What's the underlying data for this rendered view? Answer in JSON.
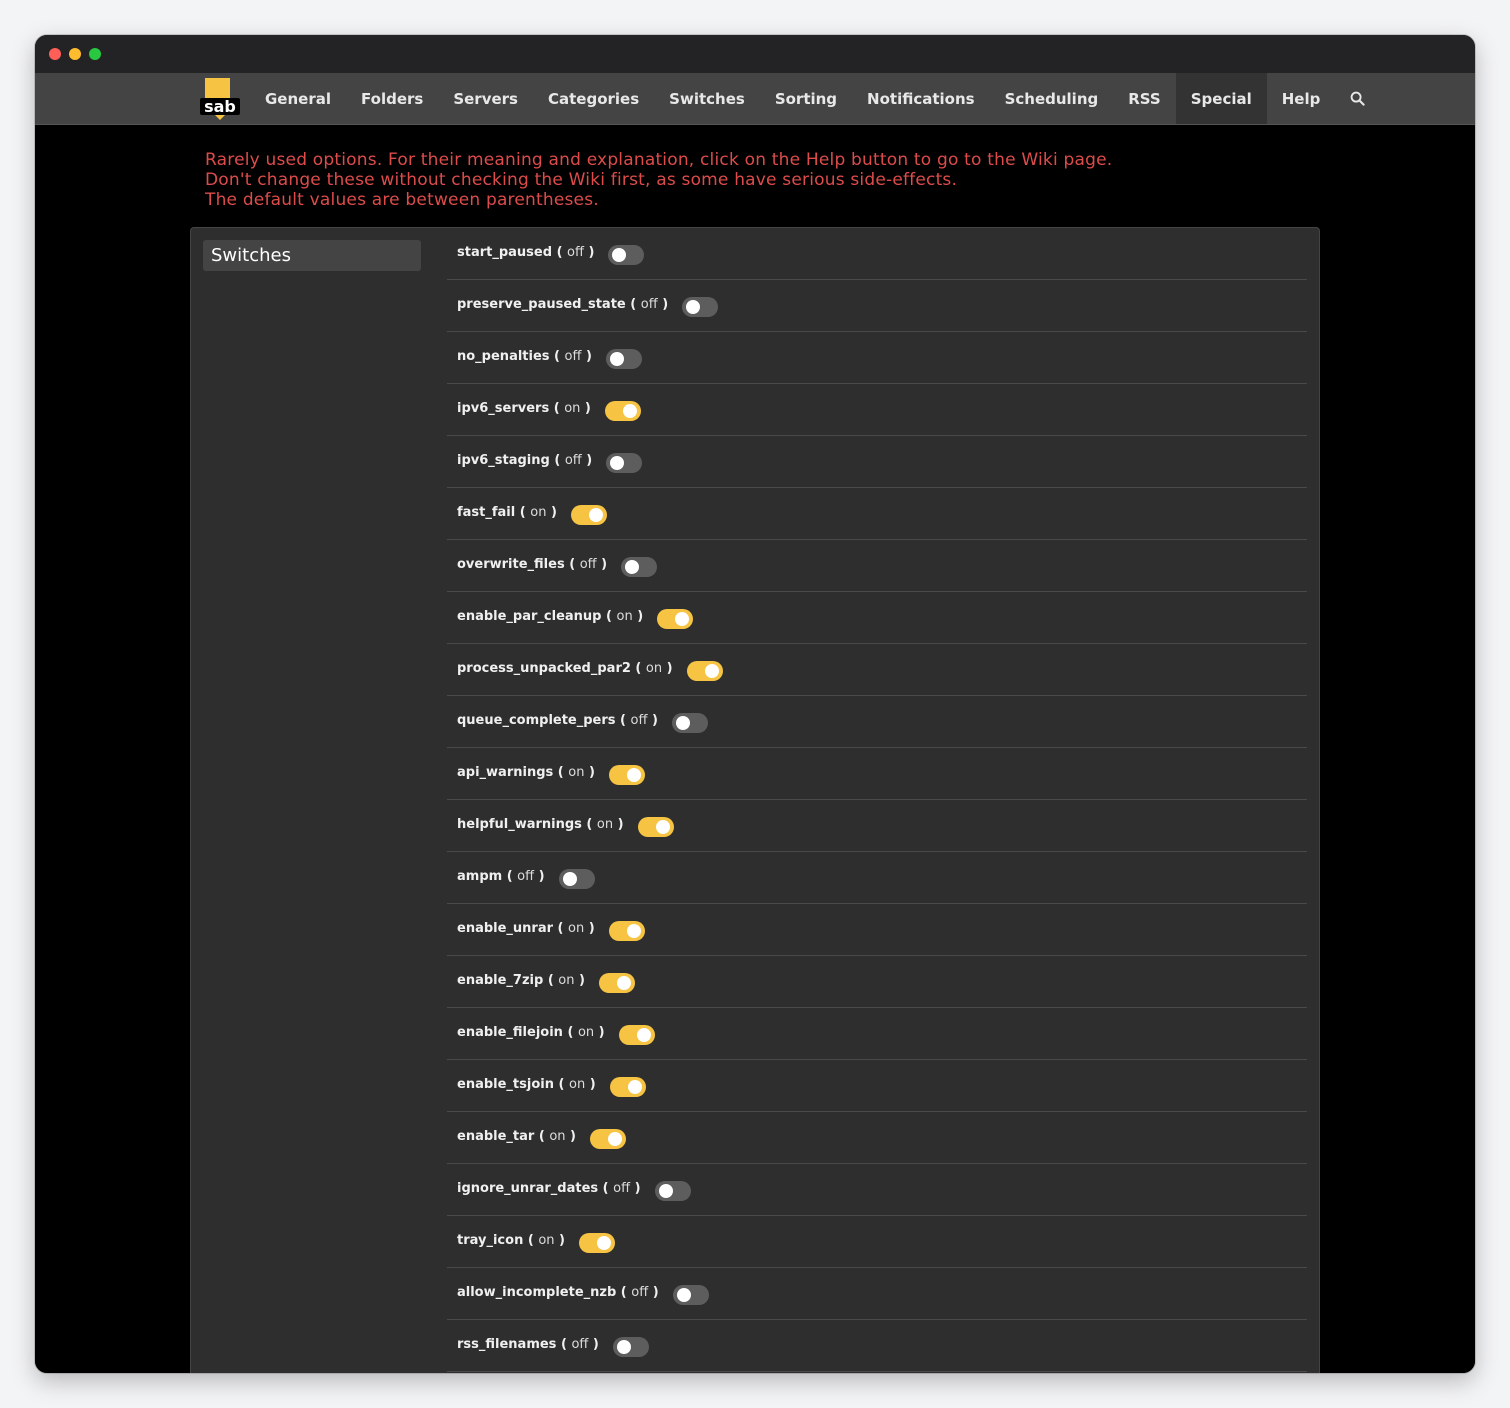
{
  "nav": {
    "logo_text": "sab",
    "items": [
      {
        "label": "General",
        "active": false
      },
      {
        "label": "Folders",
        "active": false
      },
      {
        "label": "Servers",
        "active": false
      },
      {
        "label": "Categories",
        "active": false
      },
      {
        "label": "Switches",
        "active": false
      },
      {
        "label": "Sorting",
        "active": false
      },
      {
        "label": "Notifications",
        "active": false
      },
      {
        "label": "Scheduling",
        "active": false
      },
      {
        "label": "RSS",
        "active": false
      },
      {
        "label": "Special",
        "active": true
      },
      {
        "label": "Help",
        "active": false
      }
    ],
    "search_icon": "search-icon"
  },
  "warning": {
    "line1": "Rarely used options. For their meaning and explanation, click on the Help button to go to the Wiki page.",
    "line2": "Don't change these without checking the Wiki first, as some have serious side-effects.",
    "line3": "The default values are between parentheses."
  },
  "section": {
    "title": "Switches"
  },
  "colors": {
    "accent": "#f6c343",
    "warning": "#dd4b4b",
    "toggle_off": "#5d5d5d"
  },
  "switches": [
    {
      "name": "start_paused",
      "default": "off",
      "on": false
    },
    {
      "name": "preserve_paused_state",
      "default": "off",
      "on": false
    },
    {
      "name": "no_penalties",
      "default": "off",
      "on": false
    },
    {
      "name": "ipv6_servers",
      "default": "on",
      "on": true
    },
    {
      "name": "ipv6_staging",
      "default": "off",
      "on": false
    },
    {
      "name": "fast_fail",
      "default": "on",
      "on": true
    },
    {
      "name": "overwrite_files",
      "default": "off",
      "on": false
    },
    {
      "name": "enable_par_cleanup",
      "default": "on",
      "on": true
    },
    {
      "name": "process_unpacked_par2",
      "default": "on",
      "on": true
    },
    {
      "name": "queue_complete_pers",
      "default": "off",
      "on": false
    },
    {
      "name": "api_warnings",
      "default": "on",
      "on": true
    },
    {
      "name": "helpful_warnings",
      "default": "on",
      "on": true
    },
    {
      "name": "ampm",
      "default": "off",
      "on": false
    },
    {
      "name": "enable_unrar",
      "default": "on",
      "on": true
    },
    {
      "name": "enable_7zip",
      "default": "on",
      "on": true
    },
    {
      "name": "enable_filejoin",
      "default": "on",
      "on": true
    },
    {
      "name": "enable_tsjoin",
      "default": "on",
      "on": true
    },
    {
      "name": "enable_tar",
      "default": "on",
      "on": true
    },
    {
      "name": "ignore_unrar_dates",
      "default": "off",
      "on": false
    },
    {
      "name": "tray_icon",
      "default": "on",
      "on": true
    },
    {
      "name": "allow_incomplete_nzb",
      "default": "off",
      "on": false
    },
    {
      "name": "rss_filenames",
      "default": "off",
      "on": false
    }
  ]
}
